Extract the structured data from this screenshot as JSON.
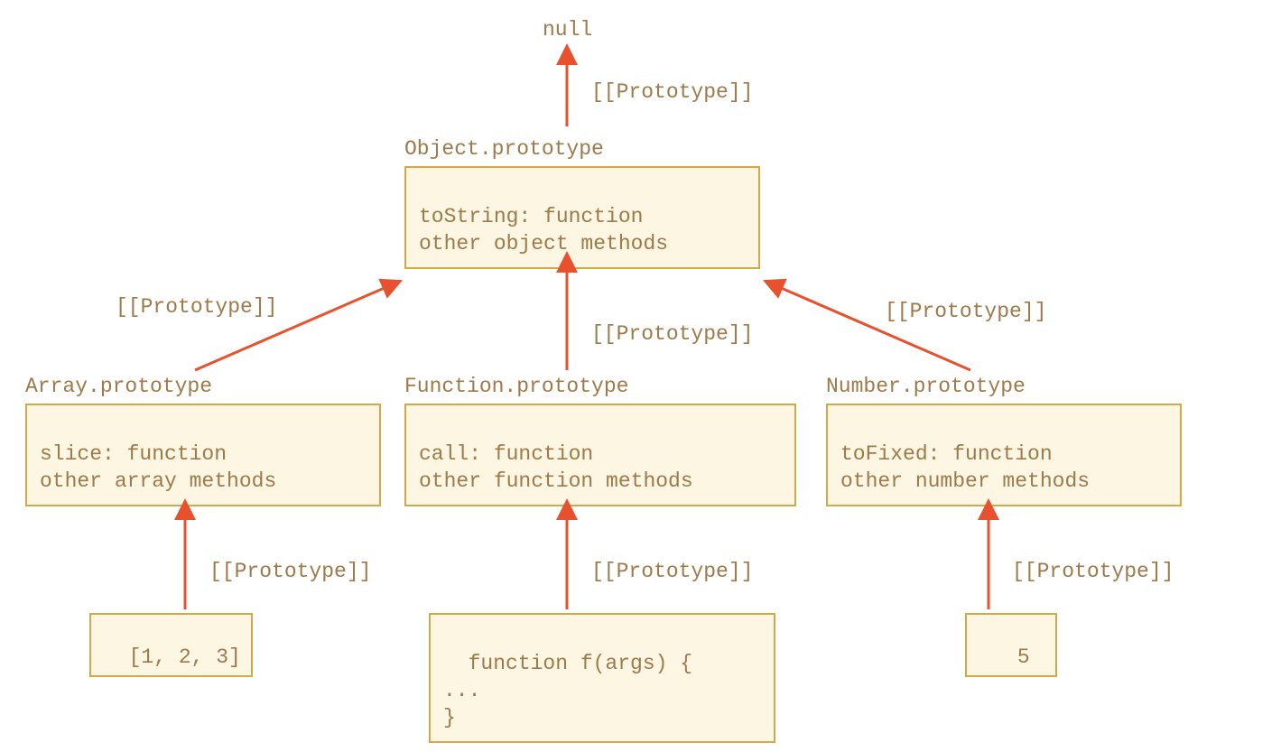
{
  "top": {
    "null_label": "null",
    "proto_label_top": "[[Prototype]]"
  },
  "object_proto": {
    "title": "Object.prototype",
    "line1": "toString: function",
    "line2": "other object methods"
  },
  "middle_arrows": {
    "left_label": "[[Prototype]]",
    "mid_label": "[[Prototype]]",
    "right_label": "[[Prototype]]"
  },
  "array_proto": {
    "title": "Array.prototype",
    "line1": "slice: function",
    "line2": "other array methods"
  },
  "function_proto": {
    "title": "Function.prototype",
    "line1": "call: function",
    "line2": "other function methods"
  },
  "number_proto": {
    "title": "Number.prototype",
    "line1": "toFixed: function",
    "line2": "other number methods"
  },
  "bottom_arrows": {
    "left_label": "[[Prototype]]",
    "mid_label": "[[Prototype]]",
    "right_label": "[[Prototype]]"
  },
  "instances": {
    "array_instance": "[1, 2, 3]",
    "function_instance": "function f(args) {\n...\n}",
    "number_instance": "5"
  },
  "colors": {
    "box_border": "#d4a848",
    "box_fill": "#fdf6e3",
    "text": "#9c7a4a",
    "arrow": "#e8512e"
  }
}
